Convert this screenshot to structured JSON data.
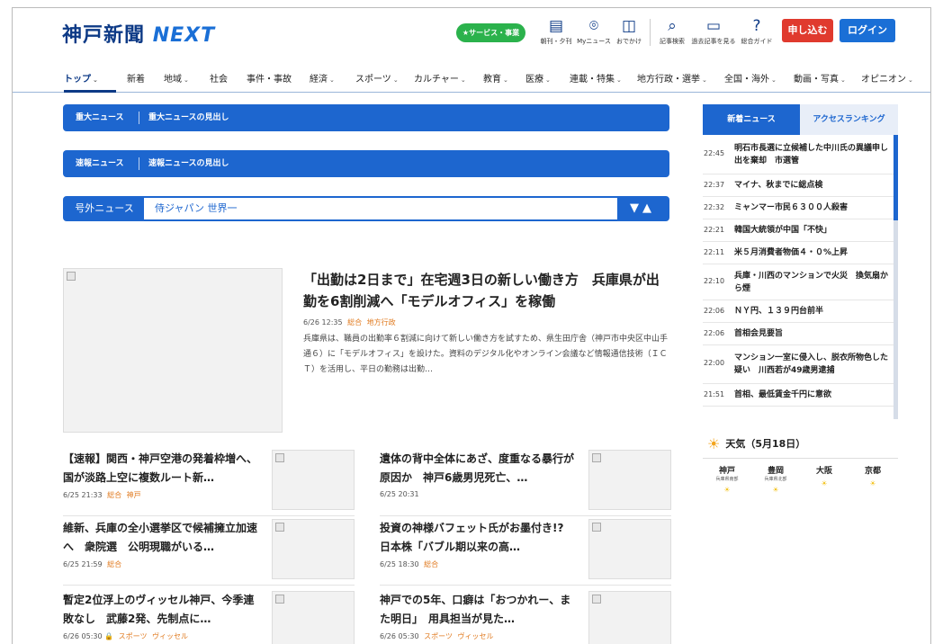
{
  "header": {
    "logo": "神戸新聞",
    "logo_next": "NEXT",
    "service_button": "★サービス・事業",
    "icons": [
      {
        "name": "newspaper-icon",
        "label": "朝刊・夕刊"
      },
      {
        "name": "location-pin-icon",
        "label": "Myニュース"
      },
      {
        "name": "suitcase-icon",
        "label": "おでかけ"
      },
      {
        "name": "search-icon",
        "label": "記事検索"
      },
      {
        "name": "past-articles-icon",
        "label": "過去記事を見る"
      },
      {
        "name": "help-icon",
        "label": "総合ガイド"
      }
    ],
    "apply_button": "申し込む",
    "login_button": "ログイン"
  },
  "nav": {
    "items": [
      {
        "label": "トップ",
        "chev": "⌄"
      },
      {
        "label": "新着",
        "chev": ""
      },
      {
        "label": "地域",
        "chev": "⌄"
      },
      {
        "label": "社会",
        "chev": ""
      },
      {
        "label": "事件・事故",
        "chev": ""
      },
      {
        "label": "経済",
        "chev": "⌄"
      },
      {
        "label": "スポーツ",
        "chev": "⌄"
      },
      {
        "label": "カルチャー",
        "chev": "⌄"
      },
      {
        "label": "教育",
        "chev": "⌄"
      },
      {
        "label": "医療",
        "chev": "⌄"
      },
      {
        "label": "連載・特集",
        "chev": "⌄"
      },
      {
        "label": "地方行政・選挙",
        "chev": "⌄"
      },
      {
        "label": "全国・海外",
        "chev": "⌄"
      },
      {
        "label": "動画・写真",
        "chev": "⌄"
      },
      {
        "label": "オピニオン",
        "chev": "⌄"
      }
    ]
  },
  "alerts": {
    "major": {
      "label": "重大ニュース",
      "title": "重大ニュースの見出し"
    },
    "breaking": {
      "label": "速報ニュース",
      "title": "速報ニュースの見出し"
    },
    "extra": {
      "label": "号外ニュース",
      "title": "侍ジャパン 世界一",
      "controls": "▼▲"
    }
  },
  "lead": {
    "title": "「出勤は2日まで」在宅週3日の新しい働き方　兵庫県が出勤を6割削減へ「モデルオフィス」を稼働",
    "time": "6/26 12:35",
    "tags": [
      "総合",
      "地方行政"
    ],
    "body": "兵庫県は、職員の出勤率６割減に向けて新しい働き方を試すため、県生田庁舎（神戸市中央区中山手通６）に「モデルオフィス」を設けた。資料のデジタル化やオンライン会議など情報通信技術（ＩＣＴ）を活用し、平日の勤務は出勤…"
  },
  "articles": [
    {
      "title": "【速報】関西・神戸空港の発着枠増へ、国が淡路上空に複数ルート新…",
      "time": "6/25 21:33",
      "tags": [
        "総合",
        "神戸"
      ]
    },
    {
      "title": "遺体の背中全体にあざ、度重なる暴行が原因か　神戸6歳男児死亡、…",
      "time": "6/25 20:31",
      "tags": []
    },
    {
      "title": "維新、兵庫の全小選挙区で候補擁立加速へ　衆院選　公明現職がいる…",
      "time": "6/25 21:59",
      "tags": [
        "総合"
      ]
    },
    {
      "title": "投資の神様バフェット氏がお墨付き!?　日本株「バブル期以来の高…",
      "time": "6/25 18:30",
      "tags": [
        "総合"
      ]
    },
    {
      "title": "暫定2位浮上のヴィッセル神戸、今季連敗なし　武藤2発、先制点に…",
      "time": "6/26 05:30",
      "lock": "🔒",
      "tags": [
        "スポーツ",
        "ヴィッセル"
      ]
    },
    {
      "title": "神戸での5年、口癖は「おつかれー、また明日」　用具担当が見た…",
      "time": "6/26 05:30",
      "tags": [
        "スポーツ",
        "ヴィッセル"
      ]
    }
  ],
  "sidebar": {
    "tab_new": "新着ニュース",
    "tab_ranking": "アクセスランキング",
    "news": [
      {
        "time": "22:45",
        "text": "明石市長選に立候補した中川氏の異議申し出を棄却　市選管"
      },
      {
        "time": "22:37",
        "text": "マイナ、秋までに総点検"
      },
      {
        "time": "22:32",
        "text": "ミャンマー市民６３００人殺害"
      },
      {
        "time": "22:21",
        "text": "韓国大統領が中国「不快」"
      },
      {
        "time": "22:11",
        "text": "米５月消費者物価４・０%上昇"
      },
      {
        "time": "22:10",
        "text": "兵庫・川西のマンションで火災　換気扇から煙"
      },
      {
        "time": "22:06",
        "text": "ＮＹ円、１３９円台前半"
      },
      {
        "time": "22:06",
        "text": "首相会見要旨"
      },
      {
        "time": "22:00",
        "text": "マンション一室に侵入し、脱衣所物色した疑い　川西若が49歳男逮捕"
      },
      {
        "time": "21:51",
        "text": "首相、最低賃金千円に意欲"
      }
    ],
    "weather_title": "天気（5月18日）",
    "weather_icon": "☀",
    "cities": [
      {
        "name": "神戸",
        "sub": "兵庫県南部"
      },
      {
        "name": "豊岡",
        "sub": "兵庫県北部"
      },
      {
        "name": "大阪",
        "sub": ""
      },
      {
        "name": "京都",
        "sub": ""
      }
    ]
  },
  "colors": {
    "brand": "#0d3a86",
    "accent": "#1d66cf",
    "apply": "#e03a2e",
    "tag": "#e07a1f",
    "service": "#2bb24c"
  }
}
